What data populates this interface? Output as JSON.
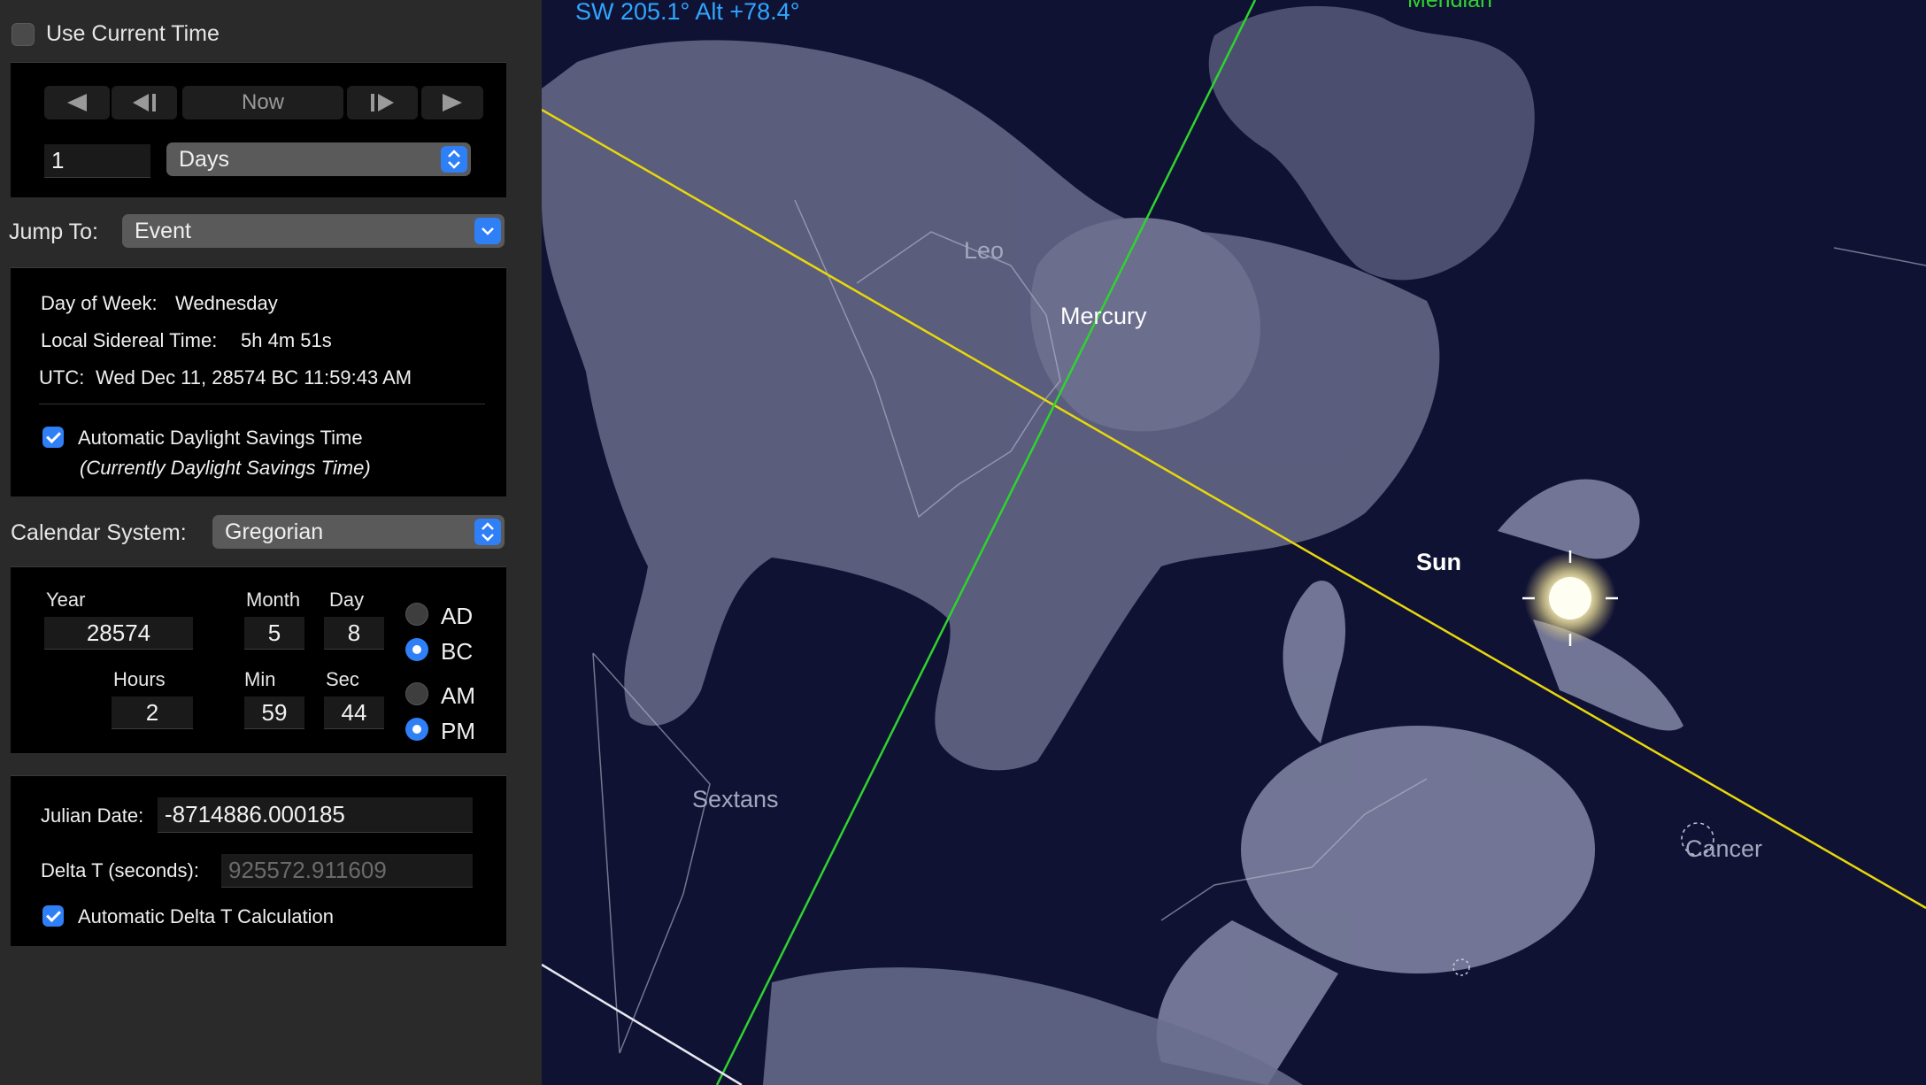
{
  "time_controls": {
    "use_current_time_label": "Use Current Time",
    "use_current_time_checked": false,
    "now_label": "Now",
    "step_value": "1",
    "step_unit": "Days",
    "jump_to_label": "Jump To:",
    "jump_to_value": "Event"
  },
  "info": {
    "day_of_week_label": "Day of Week:",
    "day_of_week": "Wednesday",
    "sidereal_label": "Local Sidereal Time:",
    "sidereal": "5h 4m 51s",
    "utc_label": "UTC:",
    "utc": "Wed Dec 11, 28574 BC 11:59:43 AM",
    "dst_label": "Automatic Daylight Savings Time",
    "dst_checked": true,
    "dst_note": "(Currently Daylight Savings Time)"
  },
  "calendar": {
    "label": "Calendar System:",
    "value": "Gregorian"
  },
  "date_fields": {
    "year_label": "Year",
    "year": "28574",
    "month_label": "Month",
    "month": "5",
    "day_label": "Day",
    "day": "8",
    "hours_label": "Hours",
    "hours": "2",
    "min_label": "Min",
    "min": "59",
    "sec_label": "Sec",
    "sec": "44",
    "ad_label": "AD",
    "bc_label": "BC",
    "era_selected": "BC",
    "am_label": "AM",
    "pm_label": "PM",
    "meridiem_selected": "PM"
  },
  "julian": {
    "julian_label": "Julian Date:",
    "julian_value": "-8714886.000185",
    "delta_t_label": "Delta T (seconds):",
    "delta_t_value": "925572.911609",
    "auto_delta_label": "Automatic Delta T Calculation",
    "auto_delta_checked": true
  },
  "sky": {
    "orientation_readout": "SW 205.1° Alt +78.4°",
    "meridian_label": "Meridian",
    "leo_label": "Leo",
    "mercury_label": "Mercury",
    "sun_label": "Sun",
    "sextans_label": "Sextans",
    "cancer_label": "Cancer",
    "colors": {
      "background": "#101234",
      "ecliptic": "#e8d80a",
      "meridian": "#2ed42e",
      "readout": "#2fa6ff"
    }
  }
}
